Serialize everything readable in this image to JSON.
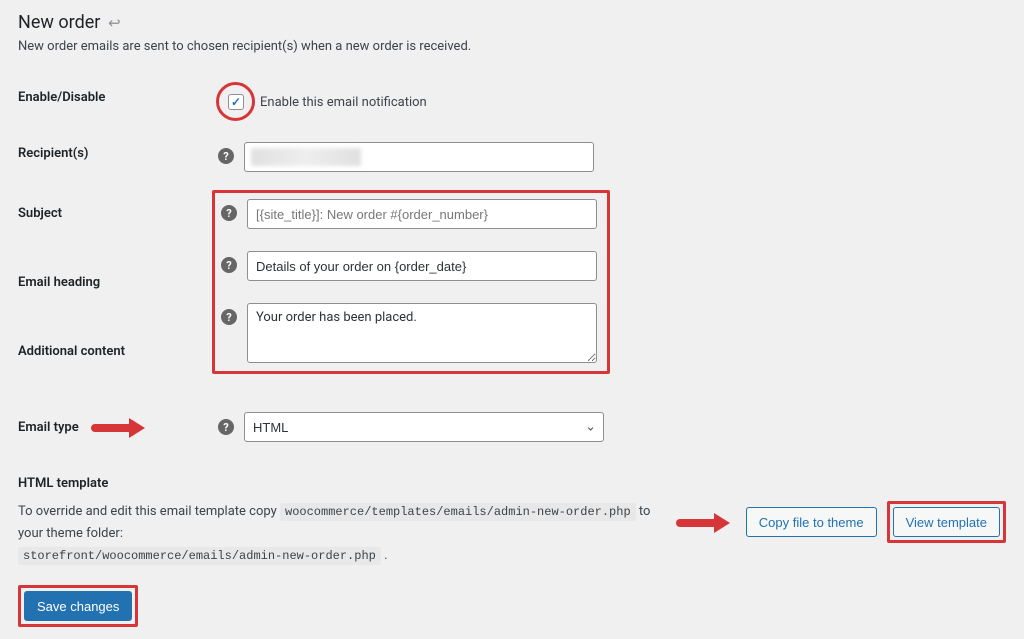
{
  "page": {
    "title": "New order",
    "description": "New order emails are sent to chosen recipient(s) when a new order is received."
  },
  "labels": {
    "enable_disable": "Enable/Disable",
    "recipients": "Recipient(s)",
    "subject": "Subject",
    "email_heading": "Email heading",
    "additional_content": "Additional content",
    "email_type": "Email type",
    "html_template": "HTML template"
  },
  "fields": {
    "enable_checkbox_label": "Enable this email notification",
    "enable_checked": true,
    "recipients_value": "",
    "subject_placeholder": "[{site_title}]: New order #{order_number}",
    "subject_value": "",
    "heading_placeholder": "",
    "heading_value": "Details of your order on {order_date}",
    "additional_content_placeholder": "",
    "additional_content_value": "Your order has been placed.",
    "email_type_selected": "HTML"
  },
  "template": {
    "desc_prefix": "To override and edit this email template copy",
    "path_source": "woocommerce/templates/emails/admin-new-order.php",
    "desc_middle": "to your theme folder:",
    "path_dest": "storefront/woocommerce/emails/admin-new-order.php",
    "copy_button": "Copy file to theme",
    "view_button": "View template"
  },
  "actions": {
    "save": "Save changes"
  }
}
